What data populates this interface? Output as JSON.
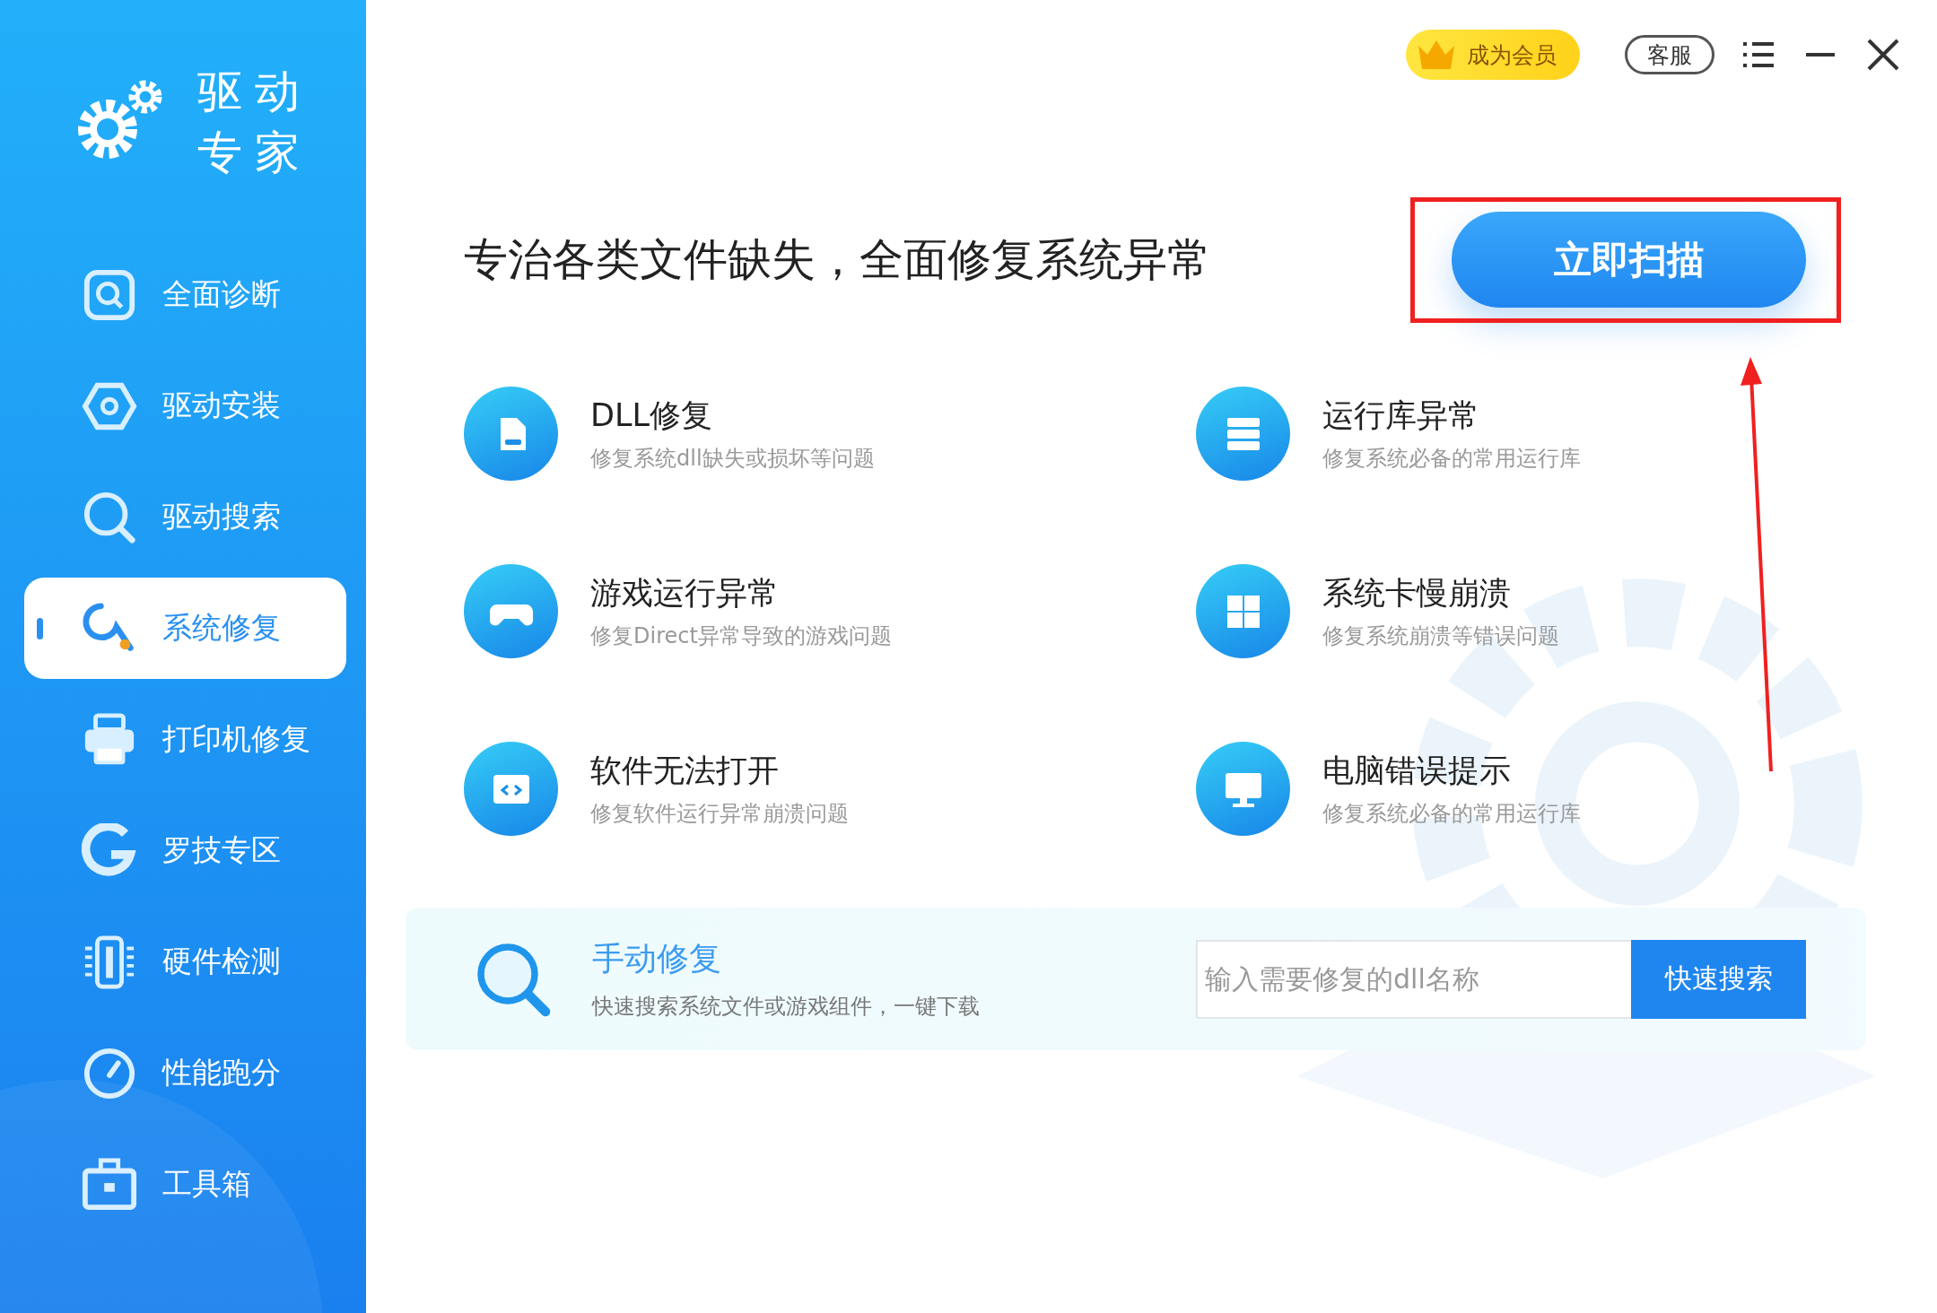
{
  "sidebar": {
    "logo_lines": [
      "驱动",
      "专家"
    ],
    "items": [
      {
        "label": "全面诊断",
        "selected": false
      },
      {
        "label": "驱动安装",
        "selected": false
      },
      {
        "label": "驱动搜索",
        "selected": false
      },
      {
        "label": "系统修复",
        "selected": true
      },
      {
        "label": "打印机修复",
        "selected": false
      },
      {
        "label": "罗技专区",
        "selected": false
      },
      {
        "label": "硬件检测",
        "selected": false
      },
      {
        "label": "性能跑分",
        "selected": false
      },
      {
        "label": "工具箱",
        "selected": false
      }
    ]
  },
  "topbar": {
    "member_button": "成为会员",
    "service_button": "客服"
  },
  "headline": "专治各类文件缺失，全面修复系统异常",
  "scan_button": "立即扫描",
  "features": [
    {
      "title": "DLL修复",
      "subtitle": "修复系统dll缺失或损坏等问题"
    },
    {
      "title": "运行库异常",
      "subtitle": "修复系统必备的常用运行库"
    },
    {
      "title": "游戏运行异常",
      "subtitle": "修复Direct异常导致的游戏问题"
    },
    {
      "title": "系统卡慢崩溃",
      "subtitle": "修复系统崩溃等错误问题"
    },
    {
      "title": "软件无法打开",
      "subtitle": "修复软件运行异常崩溃问题"
    },
    {
      "title": "电脑错误提示",
      "subtitle": "修复系统必备的常用运行库"
    }
  ],
  "manual_repair": {
    "title": "手动修复",
    "description": "快速搜索系统文件或游戏组件，一键下载",
    "search": {
      "placeholder": "输入需要修复的dll名称"
    },
    "button": "快速搜索"
  }
}
